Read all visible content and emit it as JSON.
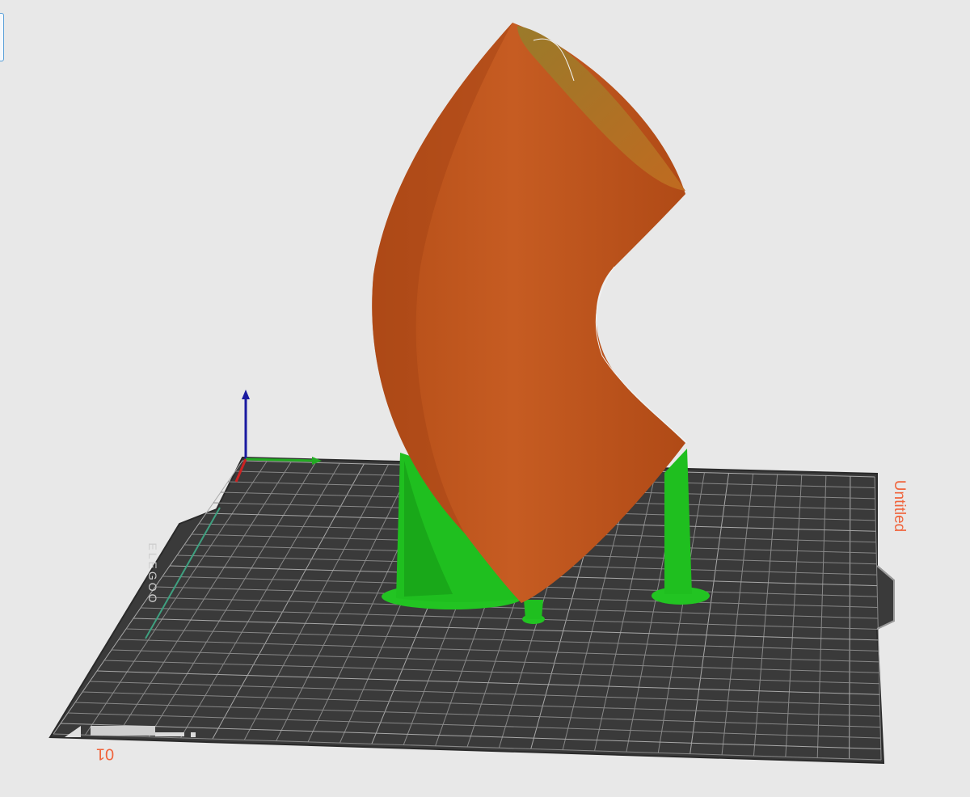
{
  "viewport": {
    "plate_name": "Untitled",
    "plate_number": "01",
    "bed_logo": "ELEGOO"
  },
  "colors": {
    "background": "#e8e8e8",
    "bed": "#3a3a3a",
    "grid": "#8a8a8a",
    "model": "#c2581f",
    "support": "#1fbf1f",
    "plate_label": "#f0643c",
    "axis_x": "#cc2222",
    "axis_y": "#22aa22",
    "axis_z": "#1a1aa0"
  }
}
